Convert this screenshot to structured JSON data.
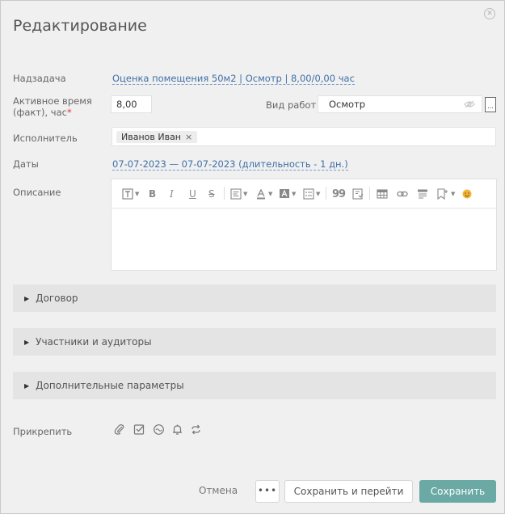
{
  "dialog": {
    "title": "Редактирование",
    "close_symbol": "✕"
  },
  "fields": {
    "parent_task": {
      "label": "Надзадача",
      "value": "Оценка помещения 50м2 | Осмотр | 8,00/0,00 час"
    },
    "active_time": {
      "label_line1": "Активное время",
      "label_line2": "(факт), час",
      "required_mark": "*",
      "value": "8,00"
    },
    "work_type": {
      "label": "Вид работ",
      "value": "Осмотр",
      "more_button": "..."
    },
    "assignee": {
      "label": "Исполнитель",
      "chip": "Иванов Иван",
      "chip_remove": "×"
    },
    "dates": {
      "label": "Даты",
      "value": "07-07-2023 — 07-07-2023 (длительность - 1 дн.)"
    },
    "description": {
      "label": "Описание"
    }
  },
  "toolbar_icons": [
    "text-format-icon",
    "bold-icon",
    "italic-icon",
    "underline-icon",
    "strikethrough-icon",
    "align-icon",
    "font-color-icon",
    "background-color-icon",
    "list-icon",
    "quote-icon",
    "paste-icon",
    "table-icon",
    "link-icon",
    "code-icon",
    "bookmark-icon",
    "emoji-icon"
  ],
  "toolbar_text": {
    "bold": "B",
    "italic": "I",
    "underline": "U",
    "strike": "S",
    "quote": "99"
  },
  "sections": [
    {
      "label": "Договор"
    },
    {
      "label": "Участники и аудиторы"
    },
    {
      "label": "Дополнительные параметры"
    }
  ],
  "attach": {
    "label": "Прикрепить",
    "icons": [
      "paperclip-icon",
      "checklist-icon",
      "meeting-icon",
      "bell-icon",
      "repeat-icon"
    ]
  },
  "footer": {
    "cancel": "Отмена",
    "more": "•••",
    "save_and_go": "Сохранить и перейти",
    "save": "Сохранить"
  },
  "colors": {
    "accent": "#6aa9a4",
    "link": "#3f6fa8",
    "background": "#f0f0f0"
  }
}
